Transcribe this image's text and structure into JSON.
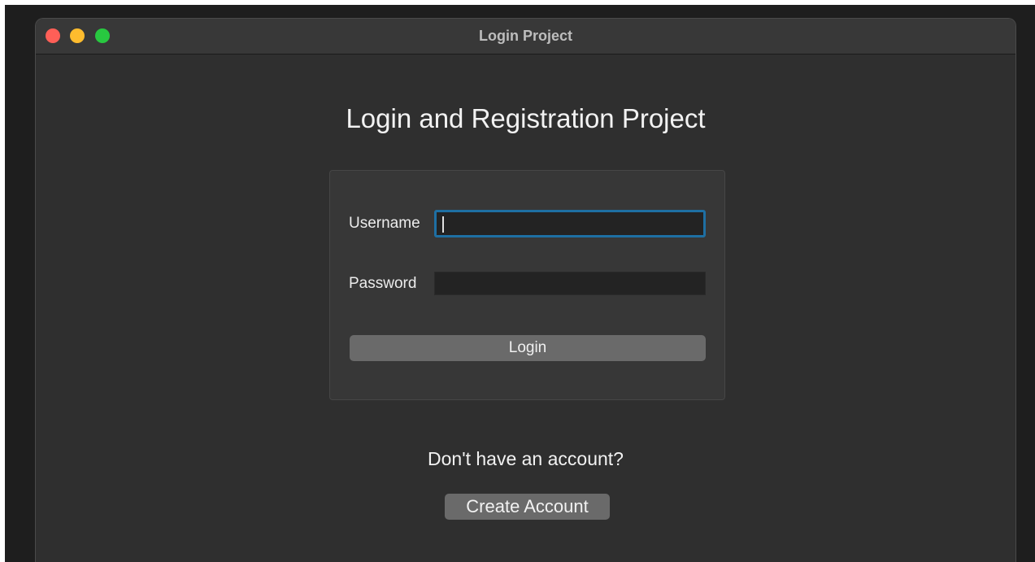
{
  "window": {
    "title": "Login Project"
  },
  "page": {
    "heading": "Login and Registration Project"
  },
  "login_form": {
    "username_label": "Username",
    "username_value": "",
    "password_label": "Password",
    "password_value": "",
    "login_label": "Login"
  },
  "register": {
    "prompt": "Don't have an account?",
    "create_label": "Create Account"
  },
  "colors": {
    "window_background": "#2f2f2f",
    "focus_ring": "#1e6fa3",
    "button": "#6a6a6a",
    "traffic_close": "#ff5f57",
    "traffic_minimize": "#febc2e",
    "traffic_zoom": "#28c840"
  }
}
